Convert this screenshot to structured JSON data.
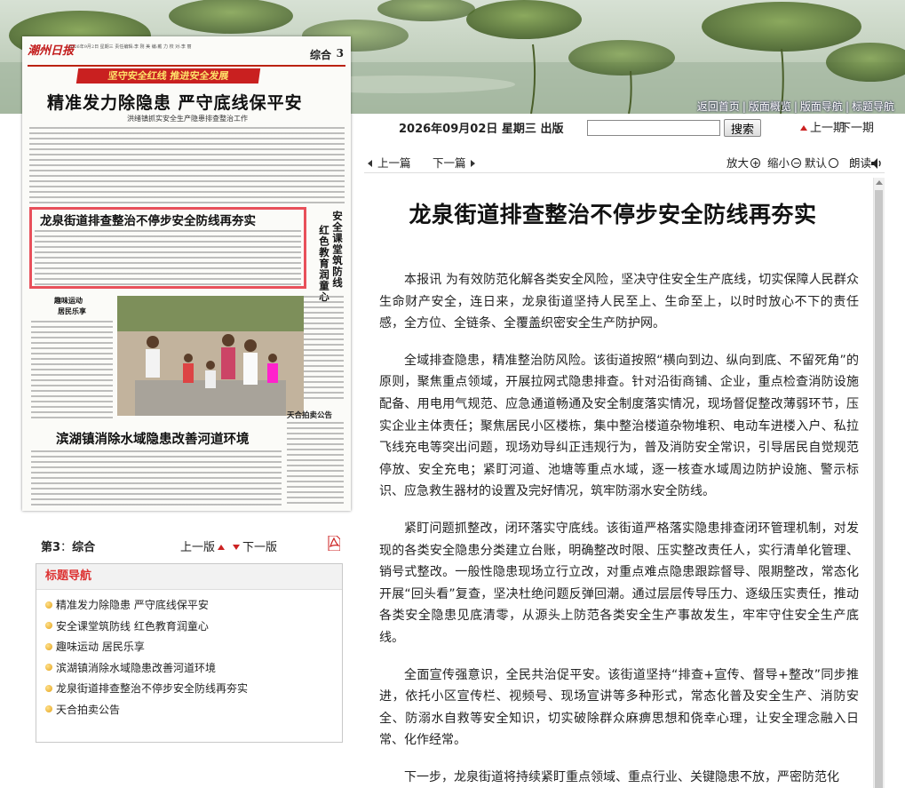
{
  "top_nav": {
    "items": [
      "返回首页",
      "版面概览",
      "版面导航",
      "标题导航"
    ],
    "separator": "|"
  },
  "date_bar": {
    "date": "2026年09月02日",
    "weekday": "星期三",
    "status": "出版"
  },
  "search": {
    "placeholder": "",
    "value": "",
    "button_label": "搜索"
  },
  "issue_nav": {
    "prev": "上一期",
    "next": "下一期"
  },
  "toolbar": {
    "prev_article": "上一篇",
    "next_article": "下一篇",
    "zoom_in": "放大",
    "zoom_out": "缩小",
    "default": "默认",
    "read_aloud": "朗读"
  },
  "newspaper_page": {
    "masthead": "潮州日报",
    "meta": "2026年9月2日  星期三  责任编辑:李 刚  美 编:戴 力  校 对:李 丽",
    "section_label": "综合",
    "page_number": "3",
    "slogan": "坚守安全红线  推进安全发展",
    "headline": "精准发力除隐患 严守底线保平安",
    "subheadline": "洪绪镇抓实安全生产隐患排查整治工作",
    "highlighted_article_title": "龙泉街道排查整治不停步安全防线再夯实",
    "vertical_title_1": "安全课堂筑防线",
    "vertical_title_2": "红色教育润童心",
    "small_title_1": "趣味运动",
    "small_title_2": "居民乐享",
    "bottom_headline": "滨湖镇消除水域隐患改善河道环境",
    "notice_title": "天合拍卖公告"
  },
  "page_info": {
    "label": "第3",
    "name": "综合",
    "prev_page": "上一版",
    "next_page": "下一版"
  },
  "title_nav": {
    "heading": "标题导航",
    "items": [
      "精准发力除隐患 严守底线保平安",
      "安全课堂筑防线 红色教育润童心",
      "趣味运动 居民乐享",
      "滨湖镇消除水域隐患改善河道环境",
      "龙泉街道排查整治不停步安全防线再夯实",
      "天合拍卖公告"
    ]
  },
  "article": {
    "title": "龙泉街道排查整治不停步安全防线再夯实",
    "paragraphs": [
      "本报讯 为有效防范化解各类安全风险，坚决守住安全生产底线，切实保障人民群众生命财产安全，连日来，龙泉街道坚持人民至上、生命至上，以时时放心不下的责任感，全方位、全链条、全覆盖织密安全生产防护网。",
      "全域排查隐患，精准整治防风险。该街道按照“横向到边、纵向到底、不留死角”的原则，聚焦重点领域，开展拉网式隐患排查。针对沿街商铺、企业，重点检查消防设施配备、用电用气规范、应急通道畅通及安全制度落实情况，现场督促整改薄弱环节，压实企业主体责任；聚焦居民小区楼栋，集中整治楼道杂物堆积、电动车进楼入户、私拉飞线充电等突出问题，现场劝导纠正违规行为，普及消防安全常识，引导居民自觉规范停放、安全充电；紧盯河道、池塘等重点水域，逐一核查水域周边防护设施、警示标识、应急救生器材的设置及完好情况，筑牢防溺水安全防线。",
      "紧盯问题抓整改，闭环落实守底线。该街道严格落实隐患排查闭环管理机制，对发现的各类安全隐患分类建立台账，明确整改时限、压实整改责任人，实行清单化管理、销号式整改。一般性隐患现场立行立改，对重点难点隐患跟踪督导、限期整改，常态化开展“回头看”复查，坚决杜绝问题反弹回潮。通过层层传导压力、逐级压实责任，推动各类安全隐患见底清零，从源头上防范各类安全生产事故发生，牢牢守住安全生产底线。",
      "全面宣传强意识，全民共治促平安。该街道坚持“排查+宣传、督导+整改”同步推进，依托小区宣传栏、视频号、现场宣讲等多种形式，常态化普及安全生产、消防安全、防溺水自救等安全知识，切实破除群众麻痹思想和侥幸心理，让安全理念融入日常、化作经常。",
      "下一步，龙泉街道将持续紧盯重点领域、重点行业、关键隐患不放，严密防范化"
    ]
  },
  "colors": {
    "accent_red": "#d33333",
    "highlight_box": "#e8505a"
  }
}
